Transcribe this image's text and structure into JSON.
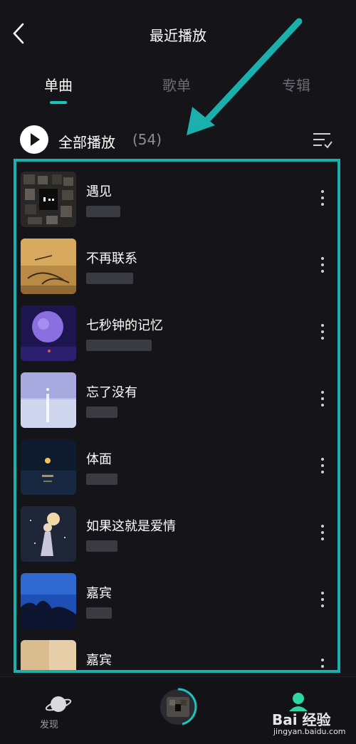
{
  "header": {
    "title": "最近播放"
  },
  "tabs": [
    {
      "label": "单曲",
      "active": true
    },
    {
      "label": "歌单",
      "active": false
    },
    {
      "label": "专辑",
      "active": false
    }
  ],
  "play_all": {
    "label": "全部播放",
    "count": "(54)"
  },
  "songs": [
    {
      "title": "遇见",
      "cover": "dark-collage"
    },
    {
      "title": "不再联系",
      "cover": "handwriting-paper"
    },
    {
      "title": "七秒钟的记忆",
      "cover": "purple-moon"
    },
    {
      "title": "忘了没有",
      "cover": "pale-sea"
    },
    {
      "title": "体面",
      "cover": "night-moon-sea"
    },
    {
      "title": "如果这就是爱情",
      "cover": "girl-moon"
    },
    {
      "title": "嘉宾",
      "cover": "blue-night-trees"
    },
    {
      "title": "嘉宾",
      "cover": "beige-paper"
    }
  ],
  "bottom_nav": {
    "discover_label": "发现"
  },
  "watermark": {
    "main": "Bai 经验",
    "sub": "jingyan.baidu.com"
  },
  "colors": {
    "accent": "#18c6c0",
    "highlight_box": "#1ab0ae",
    "background": "#141419"
  }
}
